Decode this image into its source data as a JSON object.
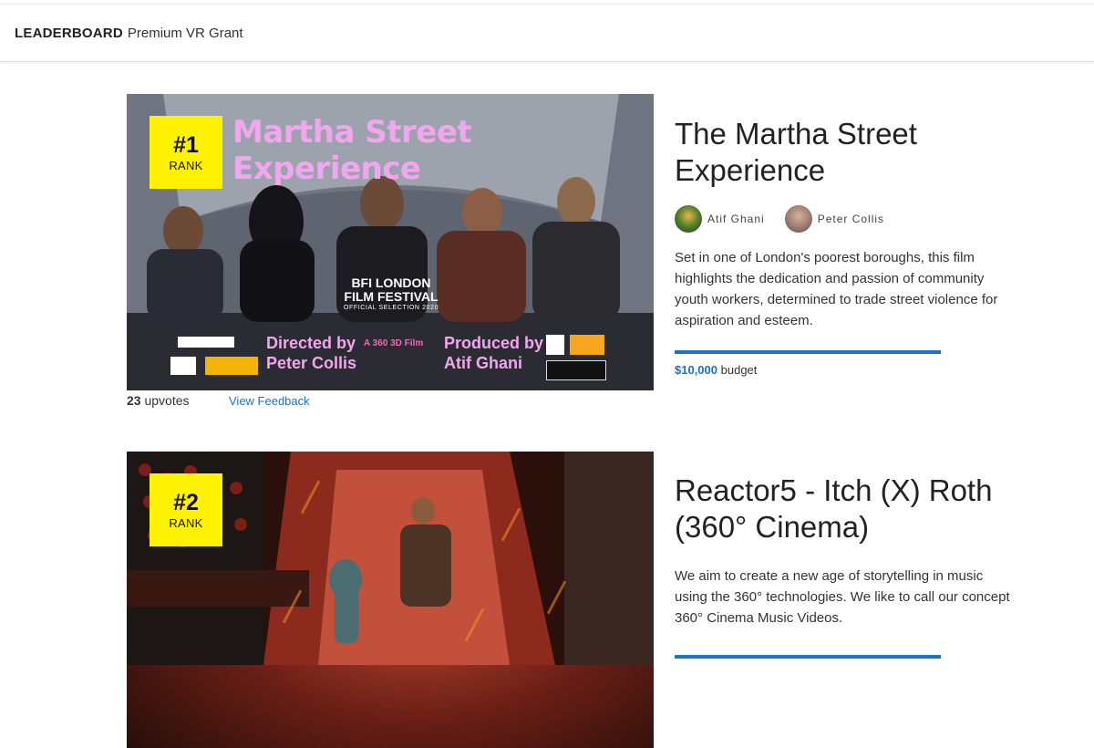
{
  "header": {
    "brand": "LEADERBOARD",
    "subtitle": "Premium VR Grant"
  },
  "colors": {
    "accent": "#1a73c7",
    "badge": "#fff200"
  },
  "entries": [
    {
      "rank_number": "#1",
      "rank_label": "RANK",
      "poster": {
        "title": "Martha Street Experience",
        "festival_line1": "BFI LONDON",
        "festival_line2": "FILM FESTIVAL",
        "festival_line3": "OFFICIAL SELECTION 2020",
        "directed_by": "Directed by",
        "director": "Peter Collis",
        "tagline": "A 360 3D Film",
        "produced_by": "Produced by",
        "producer": "Atif Ghani"
      },
      "upvotes_count": "23",
      "upvotes_label": "upvotes",
      "feedback_link": "View Feedback",
      "title": "The Martha Street Experience",
      "authors": [
        {
          "name": "Atif Ghani",
          "avatar_icon": "avatar-atif-icon"
        },
        {
          "name": "Peter Collis",
          "avatar_icon": "avatar-peter-icon"
        }
      ],
      "description": "Set in one of London's poorest boroughs, this film highlights the dedication and passion of community youth workers, determined to trade street violence for aspiration and esteem.",
      "budget_amount": "$10,000",
      "budget_label": "budget"
    },
    {
      "rank_number": "#2",
      "rank_label": "RANK",
      "title": "Reactor5 - Itch (X) Roth (360° Cinema)",
      "description": "We aim to create a new age of storytelling in music using the 360° technologies. We like to call our concept 360° Cinema Music Videos."
    }
  ]
}
